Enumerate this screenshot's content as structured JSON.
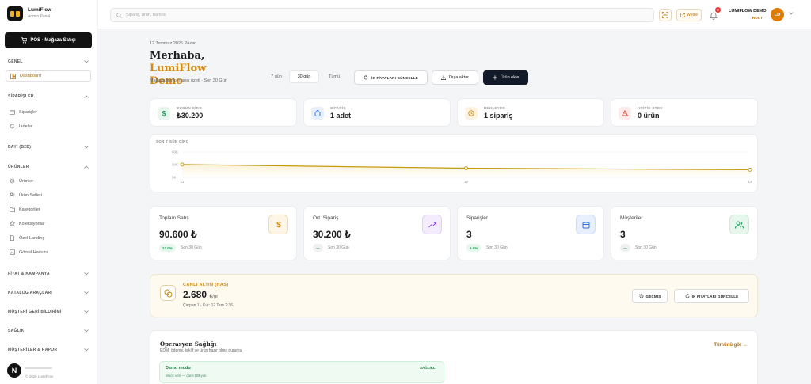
{
  "brand": {
    "name": "LumiFlow",
    "subtitle": "Admin Panel"
  },
  "sidebar": {
    "pos_button": "POS · Mağaza Satışı",
    "sections": [
      {
        "label": "GENEL"
      },
      {
        "label": "SİPARİŞLER"
      },
      {
        "label": "BAYİ (B2B)"
      },
      {
        "label": "ÜRÜNLER"
      },
      {
        "label": "FİYAT & KAMPANYA"
      },
      {
        "label": "KATALOG ARAÇLARI"
      },
      {
        "label": "MÜŞTERİ GERİ BİLDİRİMİ"
      },
      {
        "label": "SAĞLIK"
      },
      {
        "label": "MÜŞTERİLER & RAPOR"
      }
    ],
    "items": [
      {
        "label": "Dashboard",
        "icon": "dashboard-icon"
      },
      {
        "label": "Siparişler",
        "icon": "calendar-icon"
      },
      {
        "label": "İadeler",
        "icon": "refresh-icon"
      },
      {
        "label": "Ürünler",
        "icon": "gear-icon"
      },
      {
        "label": "Ürün Setleri",
        "icon": "users-icon"
      },
      {
        "label": "Kategoriler",
        "icon": "folder-icon"
      },
      {
        "label": "Koleksiyonlar",
        "icon": "star-icon"
      },
      {
        "label": "Özel Landing",
        "icon": "document-icon"
      },
      {
        "label": "Görsel Havuzu",
        "icon": "image-icon"
      }
    ],
    "footer_copyright": "© 2026 LumiFlow",
    "footer_avatar": "N"
  },
  "topbar": {
    "search_placeholder": "Sipariş, ürün, barkod",
    "web_button": "Web'e",
    "notifications_count": "8",
    "user_name": "LUMIFLOW DEMO",
    "user_role": "ROOT",
    "user_initials": "LD"
  },
  "header": {
    "date": "12 Temmuz 2026 Pazar",
    "greeting_prefix": "Merhaba,",
    "greeting_name_1": "LumiFlow",
    "greeting_name_2": "Demo",
    "subtitle": "Mağaza performansı özeti · Son 30 Gün",
    "ranges": [
      "7 gün",
      "30 gün",
      "Tümü"
    ],
    "update_prices_button": "İK FİYATLARI GÜNCELLE",
    "export_button": "Dışa aktar",
    "add_product_button": "Ürün ekle"
  },
  "kpis": [
    {
      "label": "BUGÜN CİRO",
      "value": "₺30.200",
      "icon": "dollar-icon",
      "color": "#1e9e5a",
      "bg": "#e8f7ee"
    },
    {
      "label": "SİPARİŞ",
      "value": "1 adet",
      "icon": "bag-icon",
      "color": "#2f6fe0",
      "bg": "#e9f0fd"
    },
    {
      "label": "BEKLEYEN",
      "value": "1 sipariş",
      "icon": "clock-icon",
      "color": "#d48a10",
      "bg": "#fdf3e0"
    },
    {
      "label": "KRİTİK STOK",
      "value": "0 ürün",
      "icon": "alert-icon",
      "color": "#e0483f",
      "bg": "#fdeceb"
    }
  ],
  "chart_data": {
    "type": "line",
    "title": "SON 7 GÜN CİRO",
    "x": [
      "11",
      "12",
      "13"
    ],
    "x_tick_labels": [
      "11",
      "12",
      "13"
    ],
    "values": [
      30.2,
      21.5,
      18.0
    ],
    "y_tick_labels": [
      "60K",
      "30K",
      "0K"
    ],
    "ylim": [
      0,
      60
    ],
    "grid": true,
    "color": "#c49a10"
  },
  "stats": [
    {
      "label": "Toplam Satış",
      "value": "90.600 ₺",
      "pill": "12.0%",
      "sub": "Son 30 Gün",
      "icon": "dollar-icon",
      "color": "#d48a10",
      "bg": "#fdf5e6",
      "pill_bg": "#e8f7ee",
      "pill_color": "#1e9e5a"
    },
    {
      "label": "Ort. Sipariş",
      "value": "30.200 ₺",
      "pill": "—",
      "sub": "Son 30 Gün",
      "icon": "trend-icon",
      "color": "#8a4fe0",
      "bg": "#f3ecfd",
      "pill_bg": "#eef0f2",
      "pill_color": "#1e9e5a"
    },
    {
      "label": "Siparişler",
      "value": "3",
      "pill": "6.0%",
      "sub": "Son 30 Gün",
      "icon": "calendar-icon",
      "color": "#2f6fe0",
      "bg": "#e9f0fd",
      "pill_bg": "#e8f7ee",
      "pill_color": "#1e9e5a"
    },
    {
      "label": "Müşteriler",
      "value": "3",
      "pill": "—",
      "sub": "Son 30 Gün",
      "icon": "users-icon",
      "color": "#1e9e5a",
      "bg": "#e8f7ee",
      "pill_bg": "#eef0f2",
      "pill_color": "#1e9e5a"
    }
  ],
  "gold": {
    "label": "CANLI ALTIN (HAS)",
    "value": "2.680",
    "unit": "₺/gr",
    "sub": "Çarpan 1 · Kur: 12 Tem 2:36",
    "history_button": "GEÇMİŞ",
    "update_button": "İK FİYATLARI GÜNCELLE"
  },
  "ops": {
    "title": "Operasyon Sağlığı",
    "subtitle": "EDM, ödeme, teklif ve ürün hazır olma durumu",
    "link": "Tümünü gör →",
    "box_title": "Demo modu",
    "box_sub": "Mock veri — canlı DB yok",
    "box_status": "SAĞLIKLI"
  }
}
